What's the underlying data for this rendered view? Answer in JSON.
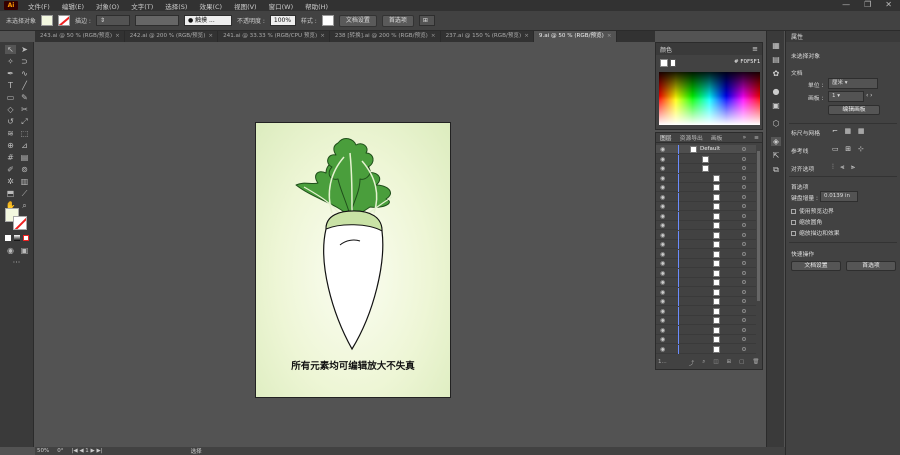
{
  "app": {
    "logo": "Ai"
  },
  "menubar": {
    "items": [
      "文件(F)",
      "编辑(E)",
      "对象(O)",
      "文字(T)",
      "选择(S)",
      "效果(C)",
      "视图(V)",
      "窗口(W)",
      "帮助(H)"
    ]
  },
  "window_controls": {
    "minimize": "—",
    "restore": "❐",
    "close": "✕"
  },
  "control_bar": {
    "selection_label": "未选择对象",
    "stroke_label": "描边 :",
    "brush_label": "● 触摸 ...",
    "opacity_label": "不透明度 :",
    "opacity_value": "100%",
    "style_label": "样式 :",
    "doc_setup_btn": "文档设置",
    "prefs_btn": "首选项",
    "fill_color": "#f3f8e0",
    "brush_icon": "brush-circle-icon"
  },
  "doc_tabs": [
    {
      "label": "243.ai @ 50 % (RGB/预览)",
      "active": false
    },
    {
      "label": "242.ai @ 200 % (RGB/预览)",
      "active": false
    },
    {
      "label": "241.ai @ 33.33 % (RGB/CPU 预览)",
      "active": false
    },
    {
      "label": "238 [转换].ai @ 200 % (RGB/预览)",
      "active": false
    },
    {
      "label": "237.ai @ 150 % (RGB/预览)",
      "active": false
    },
    {
      "label": "9.ai @ 50 % (RGB/预览)",
      "active": true
    }
  ],
  "tab_close": "×",
  "artboard": {
    "caption": "所有元素均可编辑放大不失真",
    "leaf_color": "#4a9e3c",
    "leaf_dark": "#2f7a27",
    "root_color": "#ffffff",
    "top_tint": "#c9e2a6"
  },
  "color_panel": {
    "title": "颜色",
    "hex_value": "F0F5F1",
    "menu": "≡"
  },
  "layers_panel": {
    "tabs": [
      "图层",
      "资源导出",
      "画板"
    ],
    "expand": "»",
    "menu": "≡",
    "top_layer_name": "Default",
    "footer_count": "1...",
    "rows": 22
  },
  "properties": {
    "title": "属性",
    "no_selection": "未选择对象",
    "document_section": "文档",
    "units_label": "单位 :",
    "units_value": "厘米",
    "artboard_label": "画板 :",
    "artboard_value": "1",
    "edit_artboards_btn": "编辑画板",
    "rulers_grid_label": "标尺与网格",
    "guides_label": "参考线",
    "snap_label": "对齐选项",
    "prefs_section": "首选项",
    "key_increment_label": "键盘增量 :",
    "key_increment_value": "0.0139 in",
    "check1": "使用预览边界",
    "check2": "缩放圆角",
    "check3": "缩放描边和效果",
    "quick_actions": "快速操作",
    "doc_setup_btn": "文档设置",
    "prefs_btn": "首选项"
  },
  "status_bar": {
    "zoom": "50%",
    "rotation": "0°",
    "artboard_nav": "|◀ ◀ 1 ▶ ▶|",
    "tool": "选择"
  }
}
